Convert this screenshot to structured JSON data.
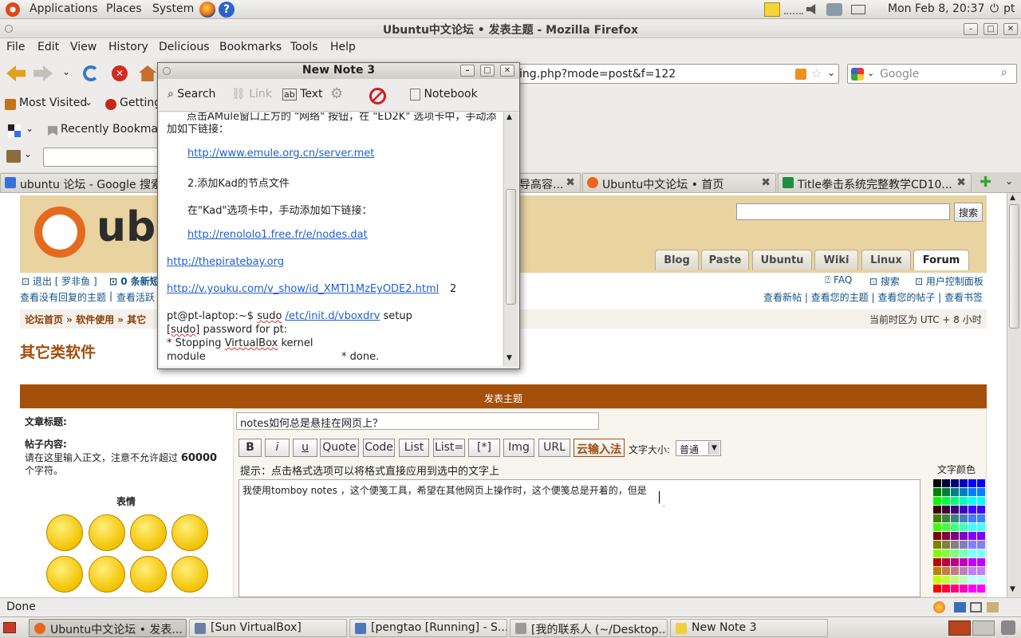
{
  "top_panel": {
    "applications": "Applications",
    "places": "Places",
    "system": "System",
    "clock": "Mon Feb  8, 20:37",
    "user": "pt"
  },
  "window": {
    "title": "Ubuntu中文论坛 • 发表主题 - Mozilla Firefox"
  },
  "menu": [
    "File",
    "Edit",
    "View",
    "History",
    "Delicious",
    "Bookmarks",
    "Tools",
    "Help"
  ],
  "nav": {
    "url": "ing.php?mode=post&f=122",
    "search_placeholder": "Google"
  },
  "bookmarks": {
    "most_visited": "Most Visited",
    "getting": "Getting",
    "recently": "Recently Bookmar"
  },
  "tabs": [
    {
      "label": "ubuntu 论坛 - Google 搜索",
      "color": "#3a6fd8"
    },
    {
      "label": "导高容...",
      "color": "#888888"
    },
    {
      "label": "Ubuntu中文论坛 • 首页",
      "color": "#e9661f"
    },
    {
      "label": "Title拳击系统完整教学CD10...",
      "color": "#1e8f42"
    }
  ],
  "forum": {
    "logo": "ubu",
    "search_btn": "搜索",
    "nav_tabs": [
      "Blog",
      "Paste",
      "Ubuntu",
      "Wiki",
      "Linux",
      "Forum"
    ],
    "logout": "退出 [ 罗非鱼 ]",
    "new_msgs": "0 条新短",
    "unanswered": "查看没有回复的主题",
    "active": "查看活跃",
    "faq": "FAQ",
    "search": "搜索",
    "ucp": "用户控制面板",
    "view_links": "查看新帖 | 查看您的主题 | 查看您的帖子 | 查看书签",
    "breadcrumb": "论坛首页 » 软件使用 » 其它",
    "timezone": "当前时区为 UTC + 8 小时",
    "page_title": "其它类软件",
    "post_header": "发表主题",
    "subject_label": "文章标题:",
    "subject_value": "notes如何总是悬挂在网页上？",
    "body_label": "帖子内容:",
    "body_hint1": "请在这里输入正文，注意不允许超过",
    "body_hint_num": "60000",
    "body_hint2": "个字符。",
    "smilies_label": "表情",
    "buttons": [
      "B",
      "i",
      "u",
      "Quote",
      "Code",
      "List",
      "List=",
      "[*]",
      "Img",
      "URL",
      "云输入法"
    ],
    "font_size_label": "文字大小:",
    "font_size_value": "普通",
    "tip": "提示：点击格式选项可以将格式直接应用到选中的文字上",
    "color_label": "文字颜色",
    "message": "我使用tomboy  notes ，这个便笺工具，希望在其他网页上操作时，这个便笺总是开着的，但是"
  },
  "note": {
    "title": "New Note 3",
    "tools": {
      "search": "Search",
      "link": "Link",
      "text": "Text",
      "notebook": "Notebook"
    },
    "lines": {
      "l0": "点击AMule窗口上方的 \"网络\" 按钮，在 \"ED2K\" 选项卡中，手动添",
      "l1": "加如下链接：",
      "l2": "http://www.emule.org.cn/server.met",
      "l3": "2.添加Kad的节点文件",
      "l4": "在\"Kad\"选项卡中，手动添加如下链接：",
      "l5": "http://renololo1.free.fr/e/nodes.dat",
      "l6": "http://thepiratebay.org",
      "l7": "http://v.youku.com/v_show/id_XMTI1MzEyODE2.html",
      "l7b": "2",
      "l8a": "pt@pt-laptop:~$",
      "l8b": "sudo",
      "l8c": "/etc/init.d/vboxdrv",
      "l8d": "setup",
      "l9a": "[sudo]",
      "l9b": "password for pt:",
      "l10a": " * Stopping",
      "l10b": "VirtualBox",
      "l10c": "kernel",
      "l11a": "module",
      "l11b": "*  done."
    }
  },
  "status": "Done",
  "taskbar": [
    {
      "label": "Ubuntu中文论坛 • 发表...",
      "color": "#e9661f"
    },
    {
      "label": "[Sun VirtualBox]",
      "color": "#6b7fa6"
    },
    {
      "label": "[pengtao [Running] - S...",
      "color": "#4a78b8"
    },
    {
      "label": "[我的联系人 (~/Desktop...",
      "color": "#9a9a9a"
    },
    {
      "label": "New Note 3",
      "color": "#f0d040"
    }
  ]
}
